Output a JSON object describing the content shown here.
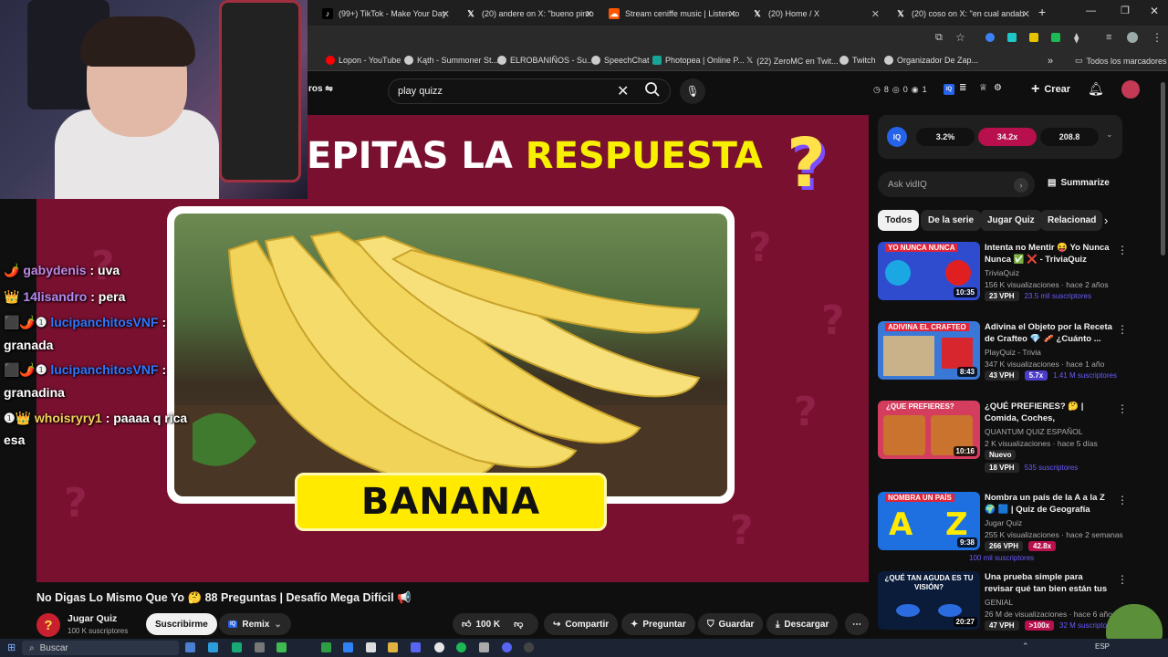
{
  "browser": {
    "tabs": [
      {
        "label": "(99+) TikTok - Make Your Day",
        "icon": "tiktok-icon"
      },
      {
        "label": "(20) andere on X: \"bueno pinto",
        "icon": "x-icon"
      },
      {
        "label": "Stream ceniffe music | Listen to",
        "icon": "soundcloud-icon"
      },
      {
        "label": "(20) Home / X",
        "icon": "x-icon"
      },
      {
        "label": "(20) coso on X: \"en cual andab",
        "icon": "x-icon"
      }
    ],
    "new_tab": "+",
    "bookmarks": [
      {
        "label": "Lopon - YouTube",
        "color": "#ff0000"
      },
      {
        "label": "Kąth - Summoner St...",
        "color": "#cccccc"
      },
      {
        "label": "ELROBANIÑOS - Su...",
        "color": "#cccccc"
      },
      {
        "label": "SpeechChat",
        "color": "#cccccc"
      },
      {
        "label": "Photopea | Online P...",
        "color": "#18a497"
      },
      {
        "label": "(22) ZeroMC en Twit...",
        "color": "#ffffff"
      },
      {
        "label": "Twitch",
        "color": "#cccccc"
      },
      {
        "label": "Organizador De Zap...",
        "color": "#cccccc"
      }
    ],
    "all_bookmarks": "Todos los marcadores"
  },
  "header": {
    "filters_partial": "ros",
    "search_value": "play quizz",
    "counters": [
      "8",
      "0",
      "1"
    ],
    "create_label": "Crear"
  },
  "video": {
    "title_white": "EPITAS LA ",
    "title_yellow": "RESPUESTA",
    "answer": "BANANA"
  },
  "chat": [
    {
      "user": "gabydenis",
      "msg": ": uva",
      "color": "#c08ae6",
      "badges": "🌶️"
    },
    {
      "user": "14lisandro",
      "msg": ": pera",
      "color": "#b48cf0",
      "badges": "👑"
    },
    {
      "user": "lucipanchitosVNF",
      "msg": ":",
      "cont": "granada",
      "color": "#2e77ff",
      "badges": "⬛🌶️❶"
    },
    {
      "user": "lucipanchitosVNF",
      "msg": ":",
      "cont": "granadina",
      "color": "#2e77ff",
      "badges": "⬛🌶️❶"
    },
    {
      "user": "whoisryry1",
      "msg": ": paaaa q rica",
      "cont": "esa",
      "color": "#f3d35a",
      "badges": "❶👑"
    }
  ],
  "below": {
    "title": "No Digas Lo Mismo Que Yo 🤔 88 Preguntas | Desafío Mega Difícil 📢",
    "channel": "Jugar Quiz",
    "subs": "100 K suscriptores",
    "subscribe": "Suscribirme",
    "remix": "Remix",
    "likes": "100 K",
    "share": "Compartir",
    "ask": "Preguntar",
    "save": "Guardar",
    "download": "Descargar"
  },
  "vidiq": {
    "stat1": "3.2%",
    "stat2": "34.2x",
    "stat3": "208.8",
    "ask_placeholder": "Ask vidIQ",
    "summarize": "Summarize"
  },
  "chips": [
    "Todos",
    "De la serie",
    "Jugar Quiz",
    "Relacionad"
  ],
  "recommendations": [
    {
      "title": "Intenta no Mentir 😝 Yo Nunca Nunca ✅ ❌ - TriviaQuiz Part...",
      "channel": "TriviaQuiz",
      "meta": "156 K visualizaciones · hace 2 años",
      "vph": "23 VPH",
      "extra": "",
      "subs": "23.5 mil suscriptores",
      "duration": "10:35",
      "thumb_text": "YO NUNCA NUNCA",
      "thumb_color": "#2f4ccf"
    },
    {
      "title": "Adivina el Objeto por la Receta de Crafteo 💎 🥓 ¿Cuánto ...",
      "channel": "PlayQuiz - Trivia",
      "meta": "347 K visualizaciones · hace 1 año",
      "vph": "43 VPH",
      "extra": "5.7x",
      "subs": "1.41 M suscriptores",
      "duration": "8:43",
      "thumb_text": "ADIVINA EL CRAFTEO",
      "thumb_color": "#3a78d8"
    },
    {
      "title": "¿QUÉ PREFIERES? 🤔 | Comida, Coches, Superpoderes y ...",
      "channel": "QUANTUM QUIZ ESPAÑOL",
      "meta": "2 K visualizaciones · hace 5 días",
      "vph": "18 VPH",
      "extra": "Nuevo",
      "subs": "535 suscriptores",
      "duration": "10:16",
      "thumb_text": "¿QUE PREFIERES?",
      "thumb_color": "#d53d5e"
    },
    {
      "title": "Nombra un país de la A a la Z 🌍 🟦 | Quiz de Geografía",
      "channel": "Jugar Quiz",
      "meta": "255 K visualizaciones · hace 2 semanas",
      "vph": "266 VPH",
      "extra": "42.8x",
      "subs": "100 mil suscriptores",
      "duration": "9:38",
      "thumb_text": "NOMBRA UN PAÍS",
      "thumb_color": "#1e6fe0"
    },
    {
      "title": "Una prueba simple para revisar qué tan bien están tus ojos",
      "channel": "GENIAL",
      "meta": "26 M de visualizaciones · hace 6 años",
      "vph": "47 VPH",
      "extra": ">100x",
      "subs": "32 M suscriptores",
      "duration": "20:27",
      "thumb_text": "¿QUÉ TAN AGUDA ES TU VISIÓN?",
      "thumb_color": "#0b1b3a"
    }
  ],
  "taskbar": {
    "search": "Buscar",
    "lang": "ESP"
  }
}
